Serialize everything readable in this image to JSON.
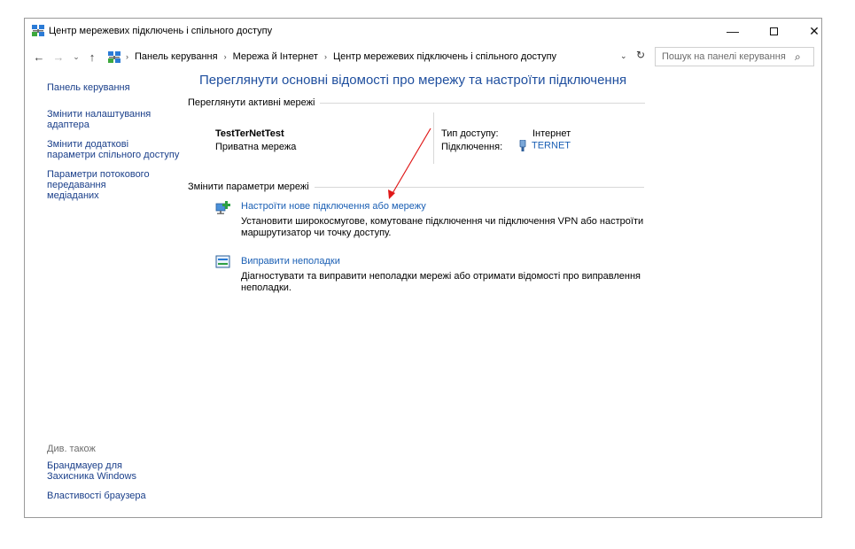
{
  "window": {
    "title": "Центр мережевих підключень і спільного доступу",
    "controls": {
      "minimize": "—",
      "close": "✕"
    }
  },
  "nav": {
    "back": "←",
    "forward": "→",
    "recent": "⌄",
    "up": "↑"
  },
  "address": {
    "crumbs": [
      "Панель керування",
      "Мережа й Інтернет",
      "Центр мережевих підключень і спільного доступу"
    ],
    "separator": "›",
    "dropdown": "⌄",
    "refresh": "↻"
  },
  "search": {
    "placeholder": "Пошук на панелі керування",
    "icon": "⌕"
  },
  "sidebar": {
    "items": [
      "Панель керування",
      "Змінити налаштування адаптера",
      "Змінити додаткові параметри спільного доступу",
      "Параметри потокового передавання медіаданих"
    ],
    "see_also_label": "Див. також",
    "see_also": [
      "Брандмауер для Захисника Windows",
      "Властивості браузера"
    ]
  },
  "main": {
    "title": "Переглянути основні відомості про мережу та настроїти підключення",
    "active_section": "Переглянути активні мережі",
    "network": {
      "name": "TestTerNetTest",
      "type": "Приватна мережа",
      "access_label": "Тип доступу:",
      "access_value": "Інтернет",
      "connections_label": "Підключення:",
      "connections_value": "TERNET"
    },
    "change_section": "Змінити параметри мережі",
    "tasks": [
      {
        "link": "Настроїти нове підключення або мережу",
        "desc": "Установити широкосмугове, комутоване підключення чи підключення VPN або настроїти маршрутизатор чи точку доступу."
      },
      {
        "link": "Виправити неполадки",
        "desc": "Діагностувати та виправити неполадки мережі або отримати відомості про виправлення неполадки."
      }
    ]
  },
  "colors": {
    "link": "#1a5fb4",
    "title": "#1e4e9e",
    "annotation_arrow": "#e01818"
  }
}
